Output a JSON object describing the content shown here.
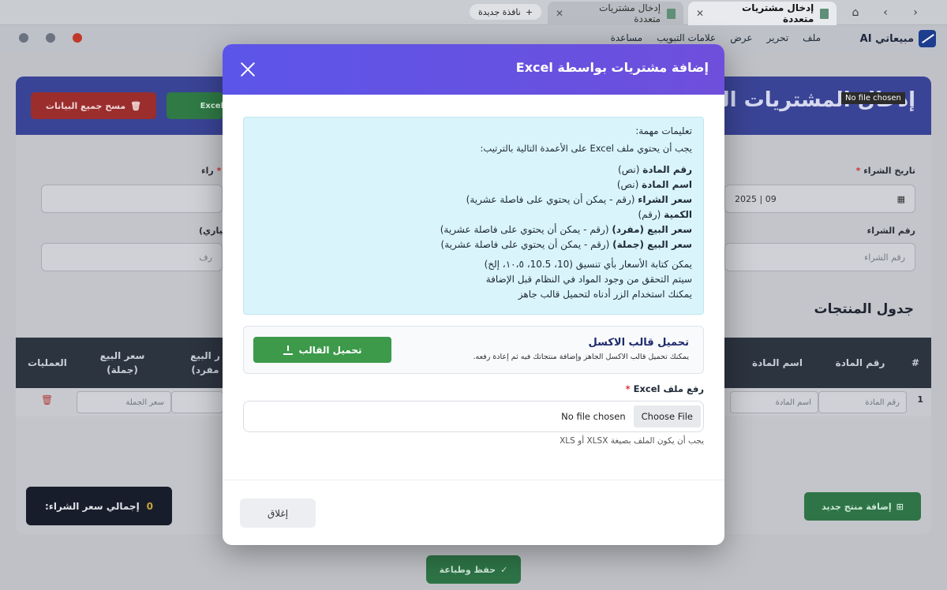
{
  "browser": {
    "tabs": [
      {
        "label": "إدخال مشتريات متعددة",
        "active": true
      },
      {
        "label": "إدخال مشتريات متعددة",
        "active": false
      }
    ],
    "new_tab_label": "نافذة جديدة"
  },
  "app": {
    "brand": "مبيعاتي AI",
    "menu": [
      "ملف",
      "تحرير",
      "عرض",
      "علامات التبويب",
      "مساعدة"
    ]
  },
  "page": {
    "header_title": "إدخال المشتريات المت",
    "clear_all_label": "مسح جميع البيانات",
    "excel_btn_label": "Excel",
    "tooltip": "No file chosen",
    "date_label": "تاريخ الشراء",
    "date_value": "09 | 2025",
    "num_label": "رقم الشراء",
    "num_placeholder": "رقم الشراء",
    "optional_label": "تياري)",
    "optional_value": "رف",
    "required_label": "راء",
    "table_title": "جدول المنتجات",
    "columns": [
      "#",
      "رقم المادة",
      "اسم المادة",
      "ر البيع\nمفرد)",
      "سعر البيع\n(جملة)",
      "العمليات"
    ],
    "row": {
      "index": "1",
      "item_no": "رقم المادة",
      "item_name": "اسم المادة",
      "wholesale": "سعر الجملة"
    },
    "total_label": "إجمالي سعر الشراء:",
    "total_value": "0",
    "add_product_label": "إضافة منتج جديد",
    "save_print_label": "حفظ وطباعة"
  },
  "modal": {
    "title": "إضافة مشتريات بواسطة Excel",
    "info_title": "تعليمات مهمة:",
    "info_sub": "يجب أن يحتوي ملف Excel على الأعمدة التالية بالترتيب:",
    "columns": [
      {
        "name": "رقم المادة",
        "desc": " (نص)"
      },
      {
        "name": "اسم المادة",
        "desc": " (نص)"
      },
      {
        "name": "سعر الشراء",
        "desc": " (رقم - يمكن أن يحتوي على فاصلة عشرية)"
      },
      {
        "name": "الكمية",
        "desc": " (رقم)"
      },
      {
        "name": "سعر البيع (مفرد)",
        "desc": " (رقم - يمكن أن يحتوي على فاصلة عشرية)"
      },
      {
        "name": "سعر البيع (جملة)",
        "desc": " (رقم - يمكن أن يحتوي على فاصلة عشرية)"
      }
    ],
    "notes": [
      "يمكن كتابة الأسعار بأي تنسيق (10، 10.5، ١٠،٥، إلخ)",
      "سيتم التحقق من وجود المواد في النظام قبل الإضافة",
      "يمكنك استخدام الزر أدناه لتحميل قالب جاهز"
    ],
    "template_title": "تحميل قالب الاكسل",
    "template_sub": "يمكنك تحميل قالب الاكسل الجاهز وإضافة منتجاتك فيه ثم إعادة رفعه.",
    "template_btn": "تحميل القالب",
    "upload_label": "رفع ملف Excel",
    "choose_file": "Choose File",
    "no_file": "No file chosen",
    "hint": "يجب أن يكون الملف بصيغة XLSX أو XLS",
    "close_btn": "إغلاق"
  }
}
